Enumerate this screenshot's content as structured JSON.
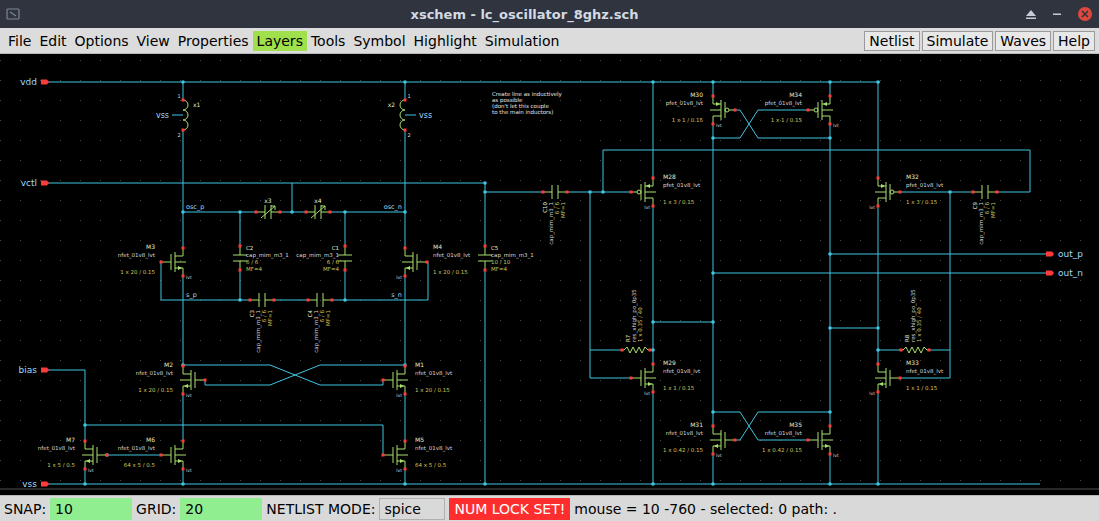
{
  "window": {
    "title": "xschem - lc_oscillator_8ghz.sch"
  },
  "menu": [
    {
      "label": "File",
      "selected": false
    },
    {
      "label": "Edit",
      "selected": false
    },
    {
      "label": "Options",
      "selected": false
    },
    {
      "label": "View",
      "selected": false
    },
    {
      "label": "Properties",
      "selected": false
    },
    {
      "label": "Layers",
      "selected": true
    },
    {
      "label": "Tools",
      "selected": false
    },
    {
      "label": "Symbol",
      "selected": false
    },
    {
      "label": "Highlight",
      "selected": false
    },
    {
      "label": "Simulation",
      "selected": false
    }
  ],
  "buttons": [
    "Netlist",
    "Simulate",
    "Waves",
    "Help"
  ],
  "schematic": {
    "pins": [
      "vdd",
      "vctl",
      "bias",
      "vss",
      "out_p",
      "out_n"
    ],
    "net_labels": [
      "osc_p",
      "osc_n",
      "s_p",
      "s_n"
    ],
    "inductors": [
      {
        "name": "x1",
        "pins": [
          "1",
          "2"
        ],
        "power": "vss"
      },
      {
        "name": "x2",
        "pins": [
          "1",
          "2"
        ],
        "power": "vss"
      }
    ],
    "varactors": [
      {
        "name": "x3"
      },
      {
        "name": "x4"
      }
    ],
    "capacitors": [
      {
        "name": "C2",
        "model": "cap_mim_m3_1",
        "size": "6 / 6",
        "mult": "MF=4"
      },
      {
        "name": "C1",
        "model": "cap_mim_m3_1",
        "size": "6 / 6",
        "mult": "MF=4"
      },
      {
        "name": "C5",
        "model": "cap_mim_m3_1",
        "size": "10 / 10",
        "mult": "MF=4"
      },
      {
        "name": "C3",
        "model": "cap_mim_m3_1",
        "size": "6 / 6",
        "mult": "MF=1"
      },
      {
        "name": "C4",
        "model": "cap_mim_m3_1",
        "size": "6 / 6",
        "mult": "MF=1"
      },
      {
        "name": "C10",
        "model": "cap_mim_m3_1",
        "size": "6 / 6",
        "mult": "MF=1"
      },
      {
        "name": "C9",
        "model": "cap_mim_m3_1",
        "size": "6 / 6",
        "mult": "MF=1"
      }
    ],
    "transistors": [
      {
        "name": "M3",
        "kind": "nfet",
        "model": "nfet_01v8_lvt",
        "params": "1 x 20 / 0.15",
        "tag": "lvt"
      },
      {
        "name": "M4",
        "kind": "nfet",
        "model": "nfet_01v8_lvt",
        "params": "1 x 20 / 0.15",
        "tag": "lvt"
      },
      {
        "name": "M2",
        "kind": "nfet",
        "model": "nfet_01v8_lvt",
        "params": "1 x 20 / 0.15",
        "tag": "lvt"
      },
      {
        "name": "M1",
        "kind": "nfet",
        "model": "nfet_01v8_lvt",
        "params": "1 x 20 / 0.15",
        "tag": "lvt"
      },
      {
        "name": "M6",
        "kind": "nfet",
        "model": "nfet_01v8_lvt",
        "params": "64 x 5 / 0.5",
        "tag": "lvt"
      },
      {
        "name": "M5",
        "kind": "nfet",
        "model": "nfet_01v8_lvt",
        "params": "64 x 5 / 0.5",
        "tag": "lvt"
      },
      {
        "name": "M7",
        "kind": "nfet",
        "model": "nfet_01v8_lvt",
        "params": "1 x 5 / 0.5",
        "tag": "lvt"
      },
      {
        "name": "M30",
        "kind": "pfet",
        "model": "pfet_01v8_lvt",
        "params": "1 x 1 / 0.15",
        "tag": "lvt"
      },
      {
        "name": "M34",
        "kind": "pfet",
        "model": "pfet_01v8_lvt",
        "params": "1 x 1 / 0.15",
        "tag": "lvt"
      },
      {
        "name": "M28",
        "kind": "pfet",
        "model": "pfet_01v8_lvt",
        "params": "1 x 3 / 0.15",
        "tag": "lvt"
      },
      {
        "name": "M32",
        "kind": "pfet",
        "model": "pfet_01v8_lvt",
        "params": "1 x 3 / 0.15",
        "tag": "lvt"
      },
      {
        "name": "M29",
        "kind": "nfet",
        "model": "nfet_01v8_lvt",
        "params": "1 x 1 / 0.15",
        "tag": "lvt"
      },
      {
        "name": "M33",
        "kind": "nfet",
        "model": "nfet_01v8_lvt",
        "params": "1 x 1 / 0.15",
        "tag": "lvt"
      },
      {
        "name": "M31",
        "kind": "nfet",
        "model": "nfet_01v8_lvt",
        "params": "1 x 0.42 / 0.15",
        "tag": "lvt"
      },
      {
        "name": "M35",
        "kind": "nfet",
        "model": "nfet_01v8_lvt",
        "params": "1 x 0.42 / 0.15",
        "tag": "lvt"
      }
    ],
    "resistors": [
      {
        "name": "R7",
        "model": "res_xhigh_po_0p35",
        "params": "1 x 0.35 / 40"
      },
      {
        "name": "R8",
        "model": "res_xhigh_po_0p35",
        "params": "1 x 0.35 / 40"
      }
    ],
    "note": [
      "Create line as inductively",
      "as possible",
      "(don't let this couple",
      "to the main inductors)"
    ]
  },
  "status": {
    "snap_label": "SNAP:",
    "snap": "10",
    "grid_label": "GRID:",
    "grid": "20",
    "mode_label": "NETLIST MODE:",
    "mode": "spice",
    "numlock": "NUM LOCK SET!",
    "info": "mouse = 10 -760 - selected: 0 path: ."
  }
}
